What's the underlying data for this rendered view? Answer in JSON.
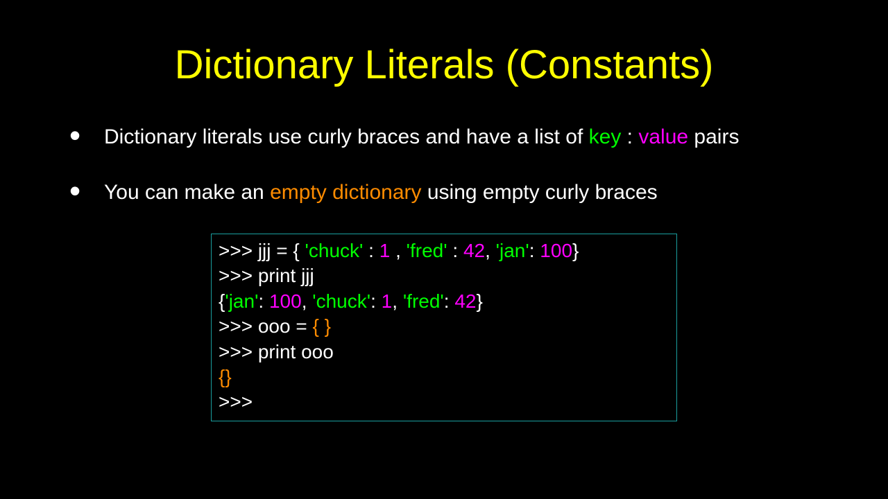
{
  "title": "Dictionary Literals (Constants)",
  "bullet1": {
    "part1": "Dictionary literals use curly braces and have a list of ",
    "key": "key",
    "colon": " : ",
    "value": "value",
    "part2": " pairs"
  },
  "bullet2": {
    "part1": "You can make ",
    "part2": "an ",
    "empty_dict": "empty dictionary",
    "part3": " using empty curly braces"
  },
  "code": {
    "l1": {
      "p": ">>> jjj = { ",
      "k1": "'chuck'",
      "c1": " : ",
      "v1": "1",
      "s1": " , ",
      "k2": "'fred'",
      "c2": " : ",
      "v2": "42",
      "s2": ", ",
      "k3": "'jan'",
      "c3": ": ",
      "v3": "100",
      "s3": "}"
    },
    "l2": ">>> print jjj",
    "l3": {
      "a": "{",
      "k1": "'jan'",
      "c1": ": ",
      "v1": "100",
      "s1": ", ",
      "k2": "'chuck'",
      "c2": ": ",
      "v2": "1",
      "s2": ", ",
      "k3": "'fred'",
      "c3": ": ",
      "v3": "42",
      "s3": "}"
    },
    "l4": {
      "p": ">>> ooo = ",
      "b": "{ }"
    },
    "l5": ">>> print ooo",
    "l6": "{}",
    "l7": ">>>"
  }
}
